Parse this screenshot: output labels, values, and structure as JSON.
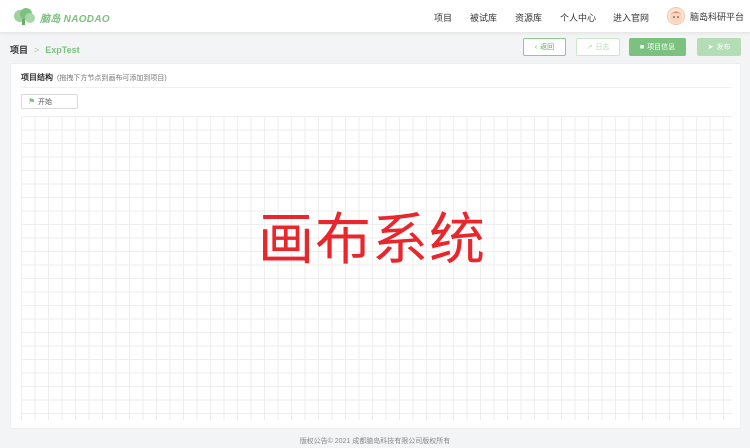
{
  "brand": {
    "name": "脑岛 NAODAO",
    "accent": "#7cc17f"
  },
  "nav": {
    "items": [
      {
        "label": "项目"
      },
      {
        "label": "被试库"
      },
      {
        "label": "资源库"
      },
      {
        "label": "个人中心"
      },
      {
        "label": "进入官网"
      }
    ],
    "user_name": "脑岛科研平台"
  },
  "breadcrumb": {
    "root": "项目",
    "separator": ">",
    "current": "ExpTest"
  },
  "toolbar": {
    "back_label": "返回",
    "log_label": "日志",
    "info_label": "项目信息",
    "publish_label": "发布"
  },
  "panel": {
    "title": "项目结构",
    "hint": "(拖拽下方节点到画布可添加到项目)",
    "start_label": "开始"
  },
  "overlay": {
    "text": "画布系统",
    "color": "#e8262b"
  },
  "footer": {
    "text": "版权公告© 2021 成都脑岛科技有限公司版权所有"
  }
}
